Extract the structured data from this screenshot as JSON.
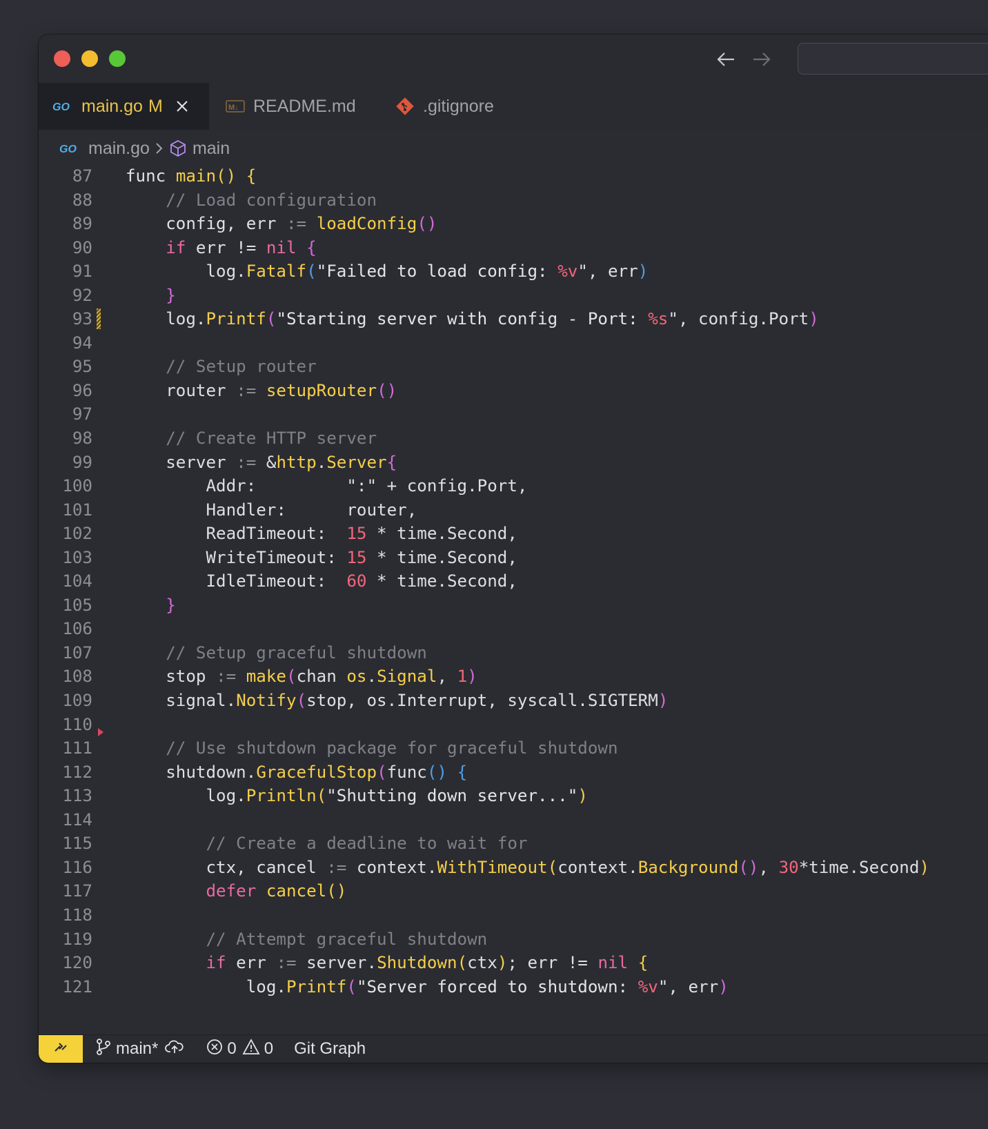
{
  "tabs": [
    {
      "icon": "go-icon",
      "label": "main.go",
      "modified": "M",
      "active": true
    },
    {
      "icon": "markdown-icon",
      "label": "README.md",
      "active": false
    },
    {
      "icon": "git-icon",
      "label": ".gitignore",
      "active": false
    }
  ],
  "breadcrumb": {
    "file": "main.go",
    "symbol": "main"
  },
  "status": {
    "branch": "main*",
    "errors": "0",
    "warnings": "0",
    "git_graph": "Git Graph"
  },
  "code": [
    {
      "n": "87",
      "s": [
        [
          "func ",
          "kw"
        ],
        [
          "main",
          "fn"
        ],
        [
          "() {",
          "br1"
        ]
      ]
    },
    {
      "n": "88",
      "s": [
        [
          "    // Load configuration",
          "cm"
        ]
      ]
    },
    {
      "n": "89",
      "s": [
        [
          "    config, err ",
          "kw"
        ],
        [
          ":=",
          "op"
        ],
        [
          " ",
          ""
        ],
        [
          "loadConfig",
          "fn"
        ],
        [
          "()",
          "br2"
        ]
      ]
    },
    {
      "n": "90",
      "s": [
        [
          "    ",
          ""
        ],
        [
          "if",
          "kwr"
        ],
        [
          " err != ",
          ""
        ],
        [
          "nil",
          "kwr"
        ],
        [
          " ",
          ""
        ],
        [
          "{",
          "br2"
        ]
      ]
    },
    {
      "n": "91",
      "s": [
        [
          "        log.",
          ""
        ],
        [
          "Fatalf",
          "fn"
        ],
        [
          "(",
          "br3"
        ],
        [
          "\"Failed to load config: ",
          "str"
        ],
        [
          "%v",
          "fmt"
        ],
        [
          "\"",
          ""
        ],
        [
          ", err",
          ""
        ],
        [
          ")",
          "br3"
        ]
      ]
    },
    {
      "n": "92",
      "s": [
        [
          "    ",
          ""
        ],
        [
          "}",
          "br2"
        ]
      ]
    },
    {
      "n": "93",
      "mark": "mod",
      "s": [
        [
          "    log.",
          ""
        ],
        [
          "Printf",
          "fn"
        ],
        [
          "(",
          "br2"
        ],
        [
          "\"Starting server with config - Port: ",
          "str"
        ],
        [
          "%s",
          "fmt"
        ],
        [
          "\"",
          ""
        ],
        [
          ", config.Port",
          ""
        ],
        [
          ")",
          "br2"
        ]
      ]
    },
    {
      "n": "94",
      "s": []
    },
    {
      "n": "95",
      "s": [
        [
          "    // Setup router",
          "cm"
        ]
      ]
    },
    {
      "n": "96",
      "s": [
        [
          "    router ",
          ""
        ],
        [
          ":=",
          "op"
        ],
        [
          " ",
          ""
        ],
        [
          "setupRouter",
          "fn"
        ],
        [
          "()",
          "br2"
        ]
      ]
    },
    {
      "n": "97",
      "s": []
    },
    {
      "n": "98",
      "s": [
        [
          "    // Create HTTP server",
          "cm"
        ]
      ]
    },
    {
      "n": "99",
      "s": [
        [
          "    server ",
          ""
        ],
        [
          ":=",
          "op"
        ],
        [
          " &",
          ""
        ],
        [
          "http",
          "fn"
        ],
        [
          ".",
          ""
        ],
        [
          "Server",
          "fn"
        ],
        [
          "{",
          "br2"
        ]
      ]
    },
    {
      "n": "100",
      "s": [
        [
          "        Addr:         \":\" + config.Port,",
          ""
        ]
      ]
    },
    {
      "n": "101",
      "s": [
        [
          "        Handler:      router,",
          ""
        ]
      ]
    },
    {
      "n": "102",
      "s": [
        [
          "        ReadTimeout:  ",
          ""
        ],
        [
          "15",
          "num"
        ],
        [
          " * time.Second,",
          ""
        ]
      ]
    },
    {
      "n": "103",
      "s": [
        [
          "        WriteTimeout: ",
          ""
        ],
        [
          "15",
          "num"
        ],
        [
          " * time.Second,",
          ""
        ]
      ]
    },
    {
      "n": "104",
      "s": [
        [
          "        IdleTimeout:  ",
          ""
        ],
        [
          "60",
          "num"
        ],
        [
          " * time.Second,",
          ""
        ]
      ]
    },
    {
      "n": "105",
      "s": [
        [
          "    ",
          ""
        ],
        [
          "}",
          "br2"
        ]
      ]
    },
    {
      "n": "106",
      "s": []
    },
    {
      "n": "107",
      "s": [
        [
          "    // Setup graceful shutdown",
          "cm"
        ]
      ]
    },
    {
      "n": "108",
      "s": [
        [
          "    stop ",
          ""
        ],
        [
          ":=",
          "op"
        ],
        [
          " ",
          ""
        ],
        [
          "make",
          "fn"
        ],
        [
          "(",
          "br2"
        ],
        [
          "chan ",
          ""
        ],
        [
          "os",
          "fn"
        ],
        [
          ".",
          ""
        ],
        [
          "Signal",
          "fn"
        ],
        [
          ", ",
          ""
        ],
        [
          "1",
          "num"
        ],
        [
          ")",
          "br2"
        ]
      ]
    },
    {
      "n": "109",
      "s": [
        [
          "    signal.",
          ""
        ],
        [
          "Notify",
          "fn"
        ],
        [
          "(",
          "br2"
        ],
        [
          "stop, os.Interrupt, syscall.SIGTERM",
          ""
        ],
        [
          ")",
          "br2"
        ]
      ]
    },
    {
      "n": "110",
      "mark": "del",
      "s": []
    },
    {
      "n": "111",
      "s": [
        [
          "    // Use shutdown package for graceful shutdown",
          "cm"
        ]
      ]
    },
    {
      "n": "112",
      "s": [
        [
          "    shutdown.",
          ""
        ],
        [
          "GracefulStop",
          "fn"
        ],
        [
          "(",
          "br2"
        ],
        [
          "func",
          ""
        ],
        [
          "()",
          "br3"
        ],
        [
          " ",
          ""
        ],
        [
          "{",
          "br3"
        ]
      ]
    },
    {
      "n": "113",
      "s": [
        [
          "        log.",
          ""
        ],
        [
          "Println",
          "fn"
        ],
        [
          "(",
          "br1"
        ],
        [
          "\"Shutting down server...\"",
          "str"
        ],
        [
          ")",
          "br1"
        ]
      ]
    },
    {
      "n": "114",
      "s": []
    },
    {
      "n": "115",
      "s": [
        [
          "        // Create a deadline to wait for",
          "cm"
        ]
      ]
    },
    {
      "n": "116",
      "s": [
        [
          "        ctx, cancel ",
          ""
        ],
        [
          ":=",
          "op"
        ],
        [
          " context.",
          ""
        ],
        [
          "WithTimeout",
          "fn"
        ],
        [
          "(",
          "br1"
        ],
        [
          "context.",
          ""
        ],
        [
          "Background",
          "fn"
        ],
        [
          "()",
          "br2"
        ],
        [
          ", ",
          ""
        ],
        [
          "30",
          "num"
        ],
        [
          "*time.Second",
          ""
        ],
        [
          ")",
          "br1"
        ]
      ]
    },
    {
      "n": "117",
      "s": [
        [
          "        ",
          ""
        ],
        [
          "defer",
          "kwr"
        ],
        [
          " ",
          ""
        ],
        [
          "cancel",
          "fn"
        ],
        [
          "()",
          "br1"
        ]
      ]
    },
    {
      "n": "118",
      "s": []
    },
    {
      "n": "119",
      "s": [
        [
          "        // Attempt graceful shutdown",
          "cm"
        ]
      ]
    },
    {
      "n": "120",
      "s": [
        [
          "        ",
          ""
        ],
        [
          "if",
          "kwr"
        ],
        [
          " err ",
          ""
        ],
        [
          ":=",
          "op"
        ],
        [
          " server.",
          ""
        ],
        [
          "Shutdown",
          "fn"
        ],
        [
          "(",
          "br1"
        ],
        [
          "ctx",
          ""
        ],
        [
          ")",
          "br1"
        ],
        [
          "; err != ",
          ""
        ],
        [
          "nil",
          "kwr"
        ],
        [
          " ",
          ""
        ],
        [
          "{",
          "br1"
        ]
      ]
    },
    {
      "n": "121",
      "s": [
        [
          "            log.",
          ""
        ],
        [
          "Printf",
          "fn"
        ],
        [
          "(",
          "br2"
        ],
        [
          "\"Server forced to shutdown: ",
          "str"
        ],
        [
          "%v",
          "fmt"
        ],
        [
          "\"",
          ""
        ],
        [
          ", err",
          ""
        ],
        [
          ")",
          "br2"
        ]
      ]
    }
  ]
}
